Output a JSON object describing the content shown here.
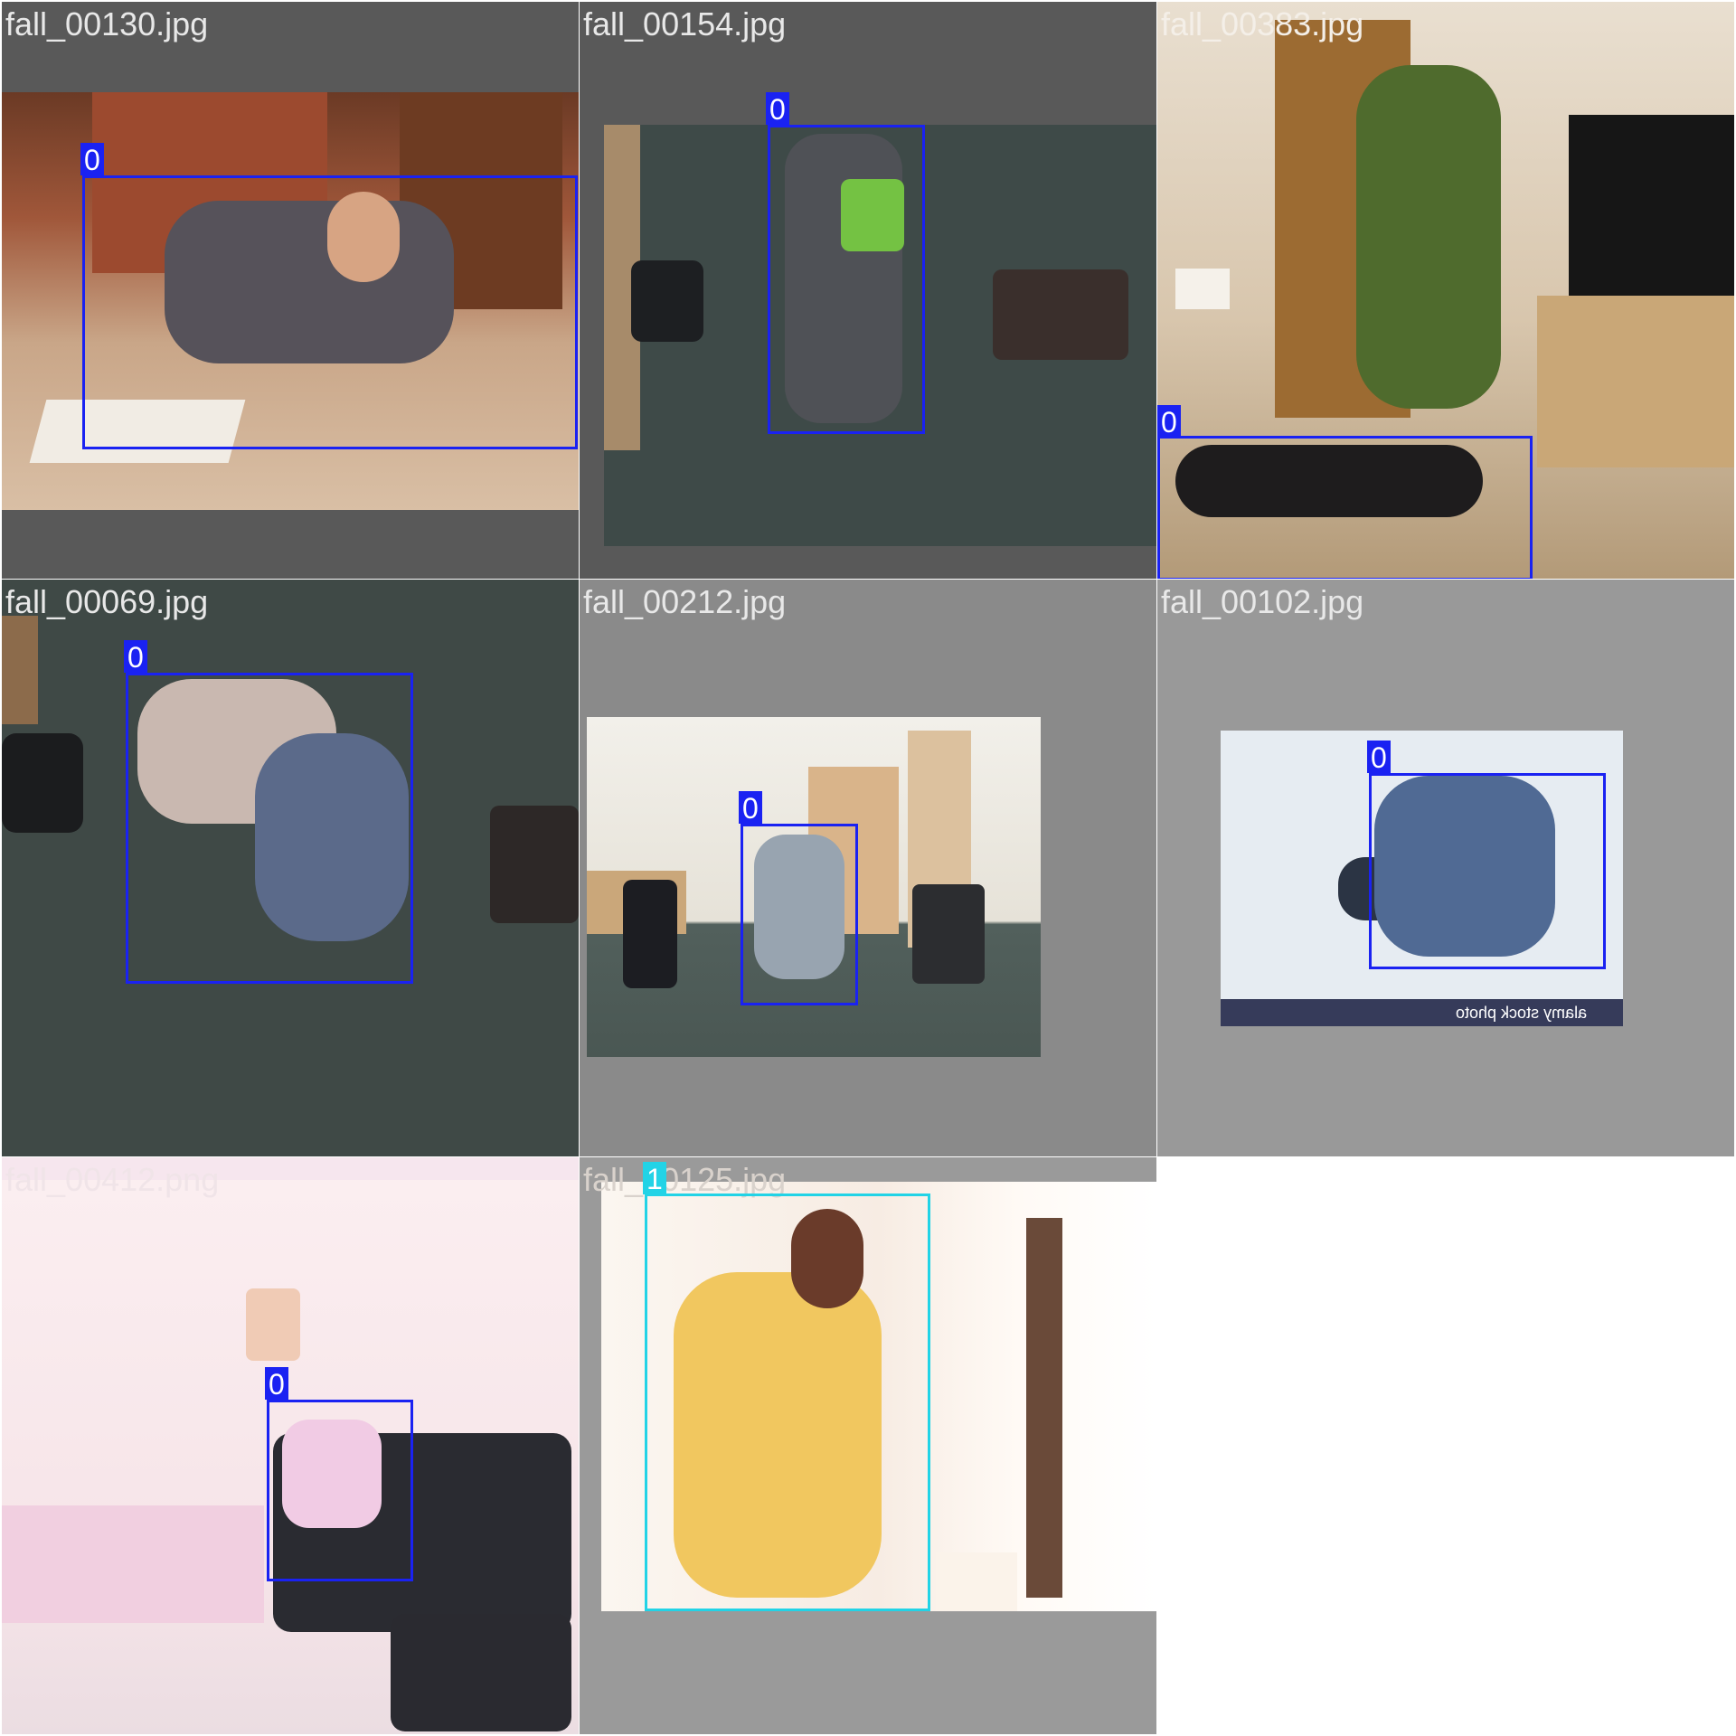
{
  "mosaic": {
    "tiles": [
      {
        "filename": "fall_00130.jpg",
        "detections": [
          {
            "class_label": "0"
          }
        ]
      },
      {
        "filename": "fall_00154.jpg",
        "detections": [
          {
            "class_label": "0"
          }
        ]
      },
      {
        "filename": "fall_00383.jpg",
        "detections": [
          {
            "class_label": "0"
          }
        ]
      },
      {
        "filename": "fall_00069.jpg",
        "detections": [
          {
            "class_label": "0"
          }
        ]
      },
      {
        "filename": "fall_00212.jpg",
        "detections": [
          {
            "class_label": "0"
          }
        ]
      },
      {
        "filename": "fall_00102.jpg",
        "detections": [
          {
            "class_label": "0"
          }
        ],
        "watermark": "alamy stock photo"
      },
      {
        "filename": "fall_00412.png",
        "detections": [
          {
            "class_label": "0"
          }
        ]
      },
      {
        "filename": "fall_10125.jpg",
        "detections": [
          {
            "class_label": "1"
          }
        ]
      }
    ]
  },
  "colors": {
    "class_0_box": "#1a22f2",
    "class_1_box": "#22d3e6",
    "filename_text": "#e8e8e8",
    "letterbox_dark": "#5a5a5a",
    "letterbox_light": "#8c8c8c",
    "background": "#ffffff"
  }
}
